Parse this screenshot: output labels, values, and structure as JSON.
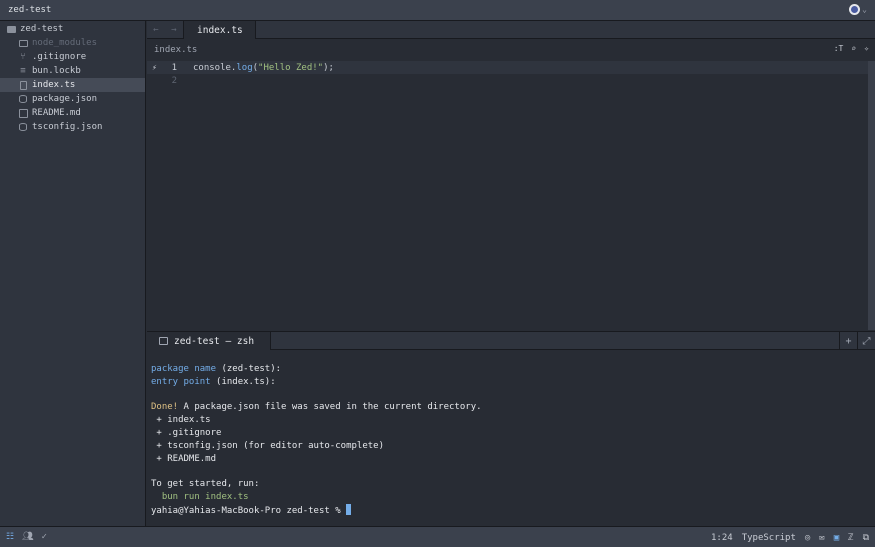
{
  "app": {
    "title": "zed-test"
  },
  "project_panel": {
    "root": "zed-test",
    "items": [
      {
        "label": "node_modules",
        "icon": "folder-icon",
        "ignored": true
      },
      {
        "label": ".gitignore",
        "icon": "git-icon"
      },
      {
        "label": "bun.lockb",
        "icon": "lines-icon"
      },
      {
        "label": "index.ts",
        "icon": "typescript-file-icon",
        "selected": true
      },
      {
        "label": "package.json",
        "icon": "database-icon"
      },
      {
        "label": "README.md",
        "icon": "book-icon"
      },
      {
        "label": "tsconfig.json",
        "icon": "database-icon"
      }
    ]
  },
  "editor": {
    "nav_back": "←",
    "nav_forward": "→",
    "tab_label": "index.ts",
    "breadcrumb": "index.ts",
    "tools": {
      "outline": ":T",
      "search": "⌕",
      "assistant": "✧"
    },
    "lines": [
      {
        "number": "1",
        "prefix": "console.",
        "method": "log",
        "open": "(",
        "string": "\"Hello Zed!\"",
        "close": ");"
      },
      {
        "number": "2"
      }
    ],
    "gutter_icon": "⚡"
  },
  "terminal": {
    "tab_label": "zed-test — zsh",
    "add": "+",
    "expand": "⤢",
    "lines": [
      {
        "cyan": "package name ",
        "plain": "(zed-test):"
      },
      {
        "cyan": "entry point ",
        "plain": "(index.ts):"
      },
      {
        "plain": ""
      },
      {
        "yellow": "Done!",
        "plain": " A package.json file was saved in the current directory."
      },
      {
        "plain": " + index.ts"
      },
      {
        "plain": " + .gitignore"
      },
      {
        "plain": " + tsconfig.json (for editor auto-complete)"
      },
      {
        "plain": " + README.md"
      },
      {
        "plain": ""
      },
      {
        "plain": "To get started, run:"
      },
      {
        "green": "  bun run index.ts"
      }
    ],
    "prompt": "yahia@Yahias-MacBook-Pro zed-test % "
  },
  "status_bar": {
    "cursor_position": "1:24",
    "language": "TypeScript",
    "accent": "#74ade8"
  }
}
